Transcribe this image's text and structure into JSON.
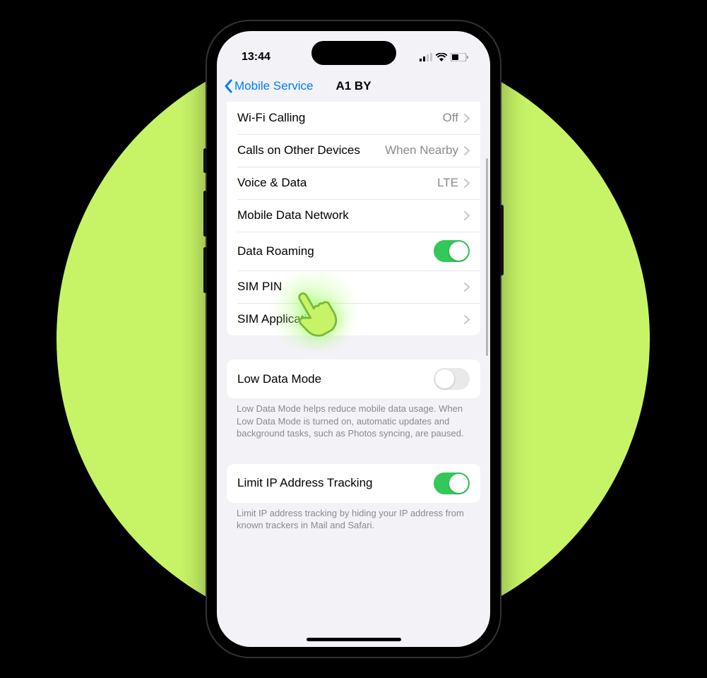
{
  "status": {
    "time": "13:44"
  },
  "nav": {
    "back_label": "Mobile Service",
    "title": "A1 BY"
  },
  "group1": {
    "wifi_calling": {
      "label": "Wi-Fi Calling",
      "value": "Off"
    },
    "calls_other": {
      "label": "Calls on Other Devices",
      "value": "When Nearby"
    },
    "voice_data": {
      "label": "Voice & Data",
      "value": "LTE"
    },
    "mobile_data_network": {
      "label": "Mobile Data Network"
    },
    "data_roaming": {
      "label": "Data Roaming",
      "on": true
    },
    "sim_pin": {
      "label": "SIM PIN"
    },
    "sim_apps": {
      "label": "SIM Applications"
    }
  },
  "group2": {
    "low_data_mode": {
      "label": "Low Data Mode",
      "on": false
    },
    "footer": "Low Data Mode helps reduce mobile data usage. When Low Data Mode is turned on, automatic updates and background tasks, such as Photos syncing, are paused."
  },
  "group3": {
    "limit_ip": {
      "label": "Limit IP Address Tracking",
      "on": true
    },
    "footer": "Limit IP address tracking by hiding your IP address from known trackers in Mail and Safari."
  }
}
